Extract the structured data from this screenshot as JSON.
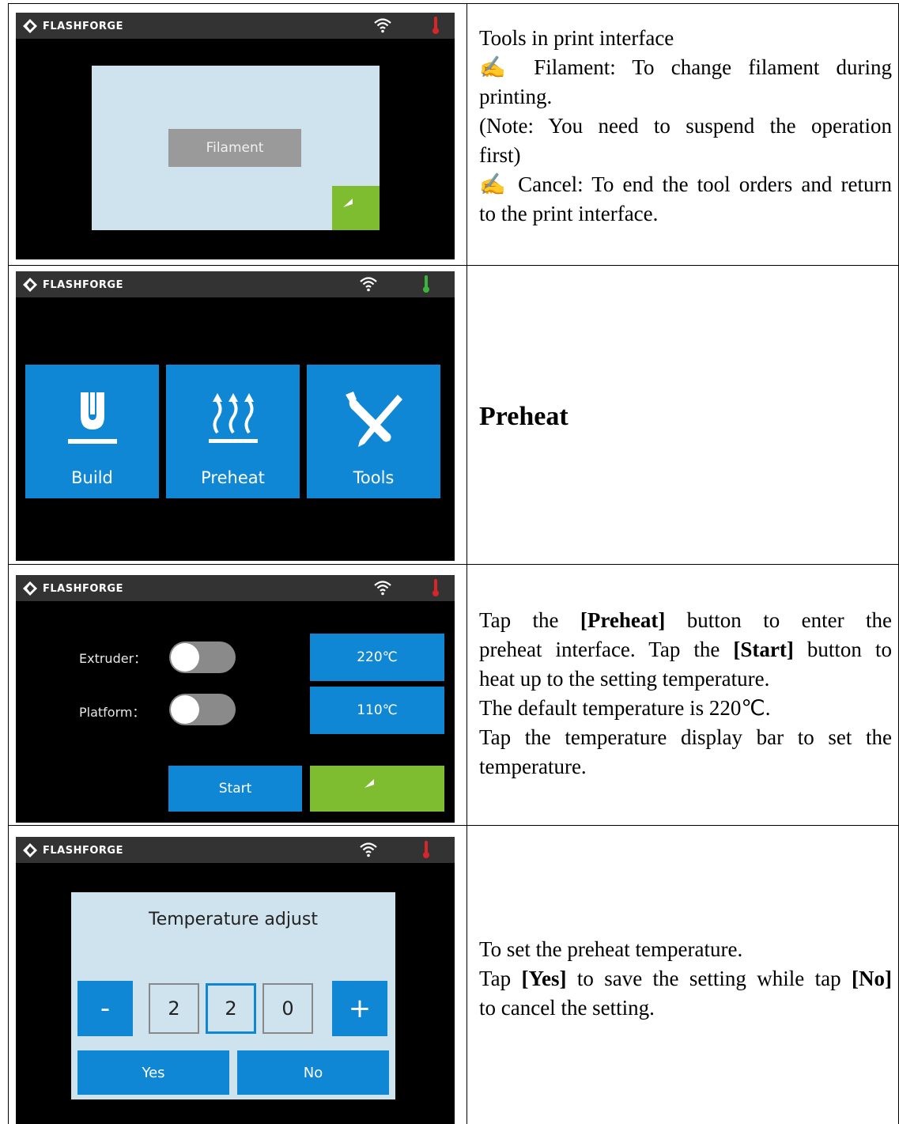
{
  "brand": "FLASHFORGE",
  "icons": [
    "flashforge-logo-icon",
    "wifi-icon",
    "thermometer-icon",
    "back-arrow-icon",
    "build-icon",
    "preheat-icon",
    "tools-icon"
  ],
  "colors": {
    "blue": "#0f87d4",
    "green": "#7ebd2f",
    "panel": "#cfe3ee",
    "gray_button": "#9a9a9a",
    "thermo_red": "#d7262b",
    "thermo_green": "#3cb43c"
  },
  "row1": {
    "screen": {
      "button": "Filament"
    },
    "text": {
      "title": "Tools in print interface",
      "item1": "✂ Filament: To change filament during printing.",
      "item1_a": "✍ Filament: To change filament during",
      "item1_b": "printing.",
      "note_a": "(Note: You need to suspend the operation",
      "note_b": "first)",
      "item2_a": "✍ Cancel: To end the tool orders and return",
      "item2_b": "to the print interface."
    }
  },
  "row2": {
    "screen": {
      "tiles": [
        "Build",
        "Preheat",
        "Tools"
      ]
    },
    "heading": "Preheat"
  },
  "row3": {
    "screen": {
      "extruder_label": "Extruder：",
      "platform_label": "Platform：",
      "extruder_temp": "220℃",
      "platform_temp": "110℃",
      "start": "Start",
      "extruder_on": false,
      "platform_on": false
    },
    "text": {
      "l1_pre": "Tap the ",
      "l1_b": "[Preheat]",
      "l1_post": " button to enter the",
      "l2_pre": "preheat interface. Tap the ",
      "l2_b": "[Start]",
      "l2_post": " button to",
      "l3": "heat up to the setting temperature.",
      "l4": "The default temperature is 220℃.",
      "l5": "Tap the temperature display bar to set the",
      "l6": "temperature."
    }
  },
  "row4": {
    "screen": {
      "title": "Temperature adjust",
      "minus": "-",
      "plus": "+",
      "digits": [
        "2",
        "2",
        "0"
      ],
      "yes": "Yes",
      "no": "No"
    },
    "text": {
      "l1": "To set the preheat temperature.",
      "l2_pre": "Tap ",
      "l2_b1": "[Yes]",
      "l2_mid": " to save the setting while tap ",
      "l2_b2": "[No]",
      "l3": "to cancel the setting."
    }
  }
}
